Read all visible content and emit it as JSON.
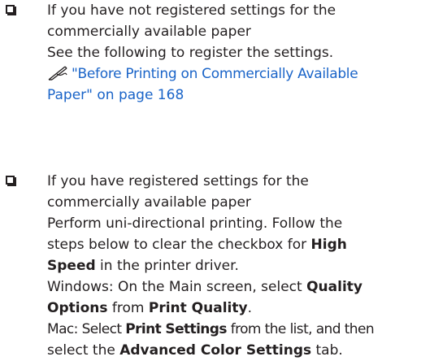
{
  "items": [
    {
      "line1": "If you have not registered settings for the",
      "line2": "commercially available paper",
      "line3": "See the following to register the settings.",
      "link_line1": "\"Before Printing on Commercially Available",
      "link_line2": "Paper\" on page 168"
    },
    {
      "line1": "If you have registered settings for the",
      "line2": "commercially available paper",
      "line3": "Perform uni-directional printing. Follow the",
      "line4": "steps below to clear the checkbox for",
      "line4_bold": "High",
      "line5_bold": "Speed",
      "line5": " in the printer driver.",
      "win_text": "Windows: On the Main screen, select ",
      "win_bold1": "Quality",
      "win_bold2": "Options",
      "win_mid": " from ",
      "win_bold3": "Print Quality",
      "win_end": ".",
      "mac_text": "Mac: Select ",
      "mac_bold1": "Print Settings",
      "mac_mid": " from the list, and then",
      "mac_line2": "select the ",
      "mac_bold2": "Advanced Color Settings",
      "mac_end": " tab."
    }
  ]
}
